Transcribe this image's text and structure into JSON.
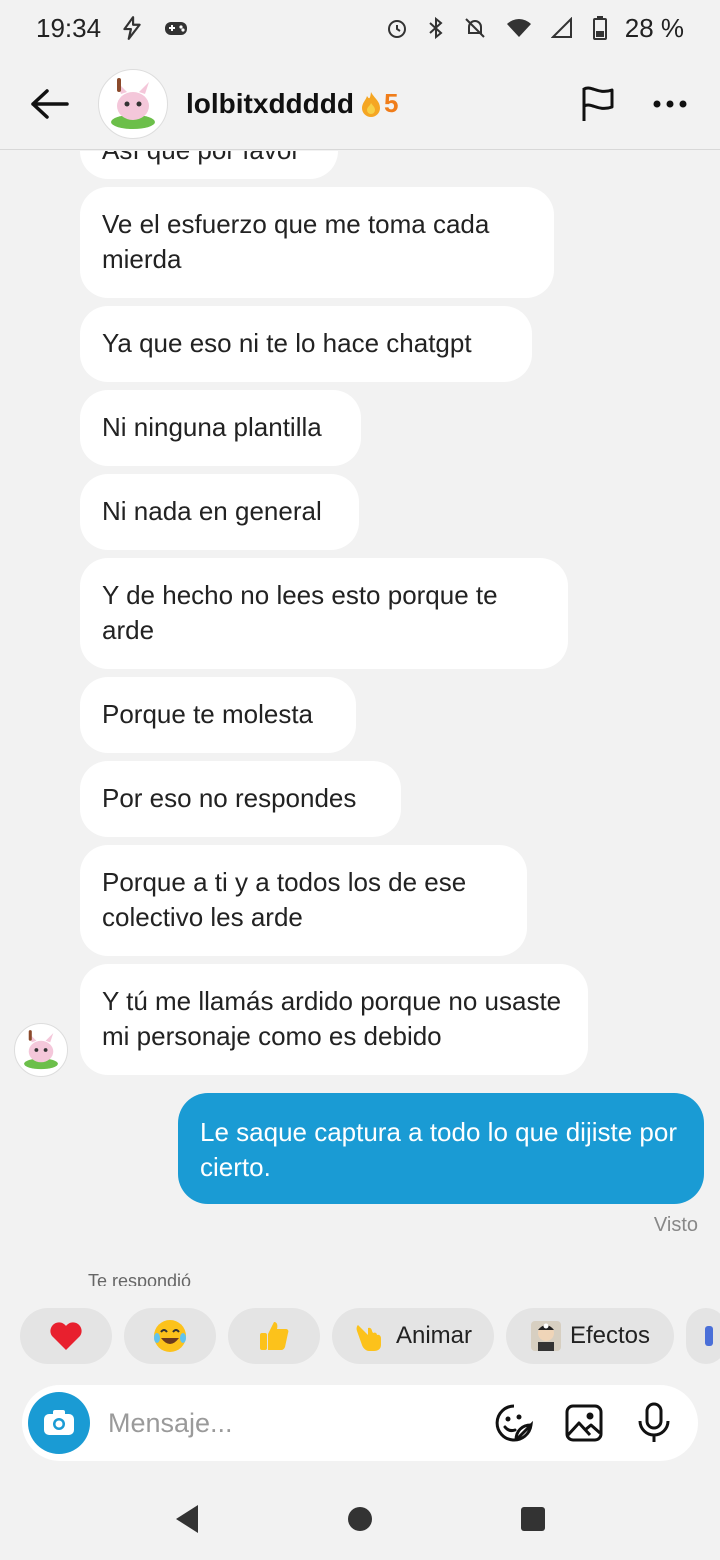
{
  "status": {
    "time": "19:34",
    "battery": "28 %"
  },
  "header": {
    "username": "lolbitxddddd",
    "streak": "5"
  },
  "messages": [
    {
      "text": "Así que por favor"
    },
    {
      "text": "Ve el esfuerzo que me toma cada mierda"
    },
    {
      "text": "Ya que eso ni te lo hace chatgpt"
    },
    {
      "text": "Ni ninguna plantilla"
    },
    {
      "text": "Ni nada en general"
    },
    {
      "text": "Y de hecho no lees esto porque te arde"
    },
    {
      "text": "Porque te molesta"
    },
    {
      "text": "Por eso no respondes"
    },
    {
      "text": "Porque a ti y a todos los de ese colectivo les arde"
    },
    {
      "text": "Y tú me llamás ardido porque no usaste mi personaje como es debido"
    }
  ],
  "my_message": "Le saque captura a todo lo que dijiste por cierto.",
  "seen_label": "Visto",
  "replied_label": "Te respondió",
  "chips": {
    "animar": "Animar",
    "efectos": "Efectos"
  },
  "composer": {
    "placeholder": "Mensaje..."
  }
}
